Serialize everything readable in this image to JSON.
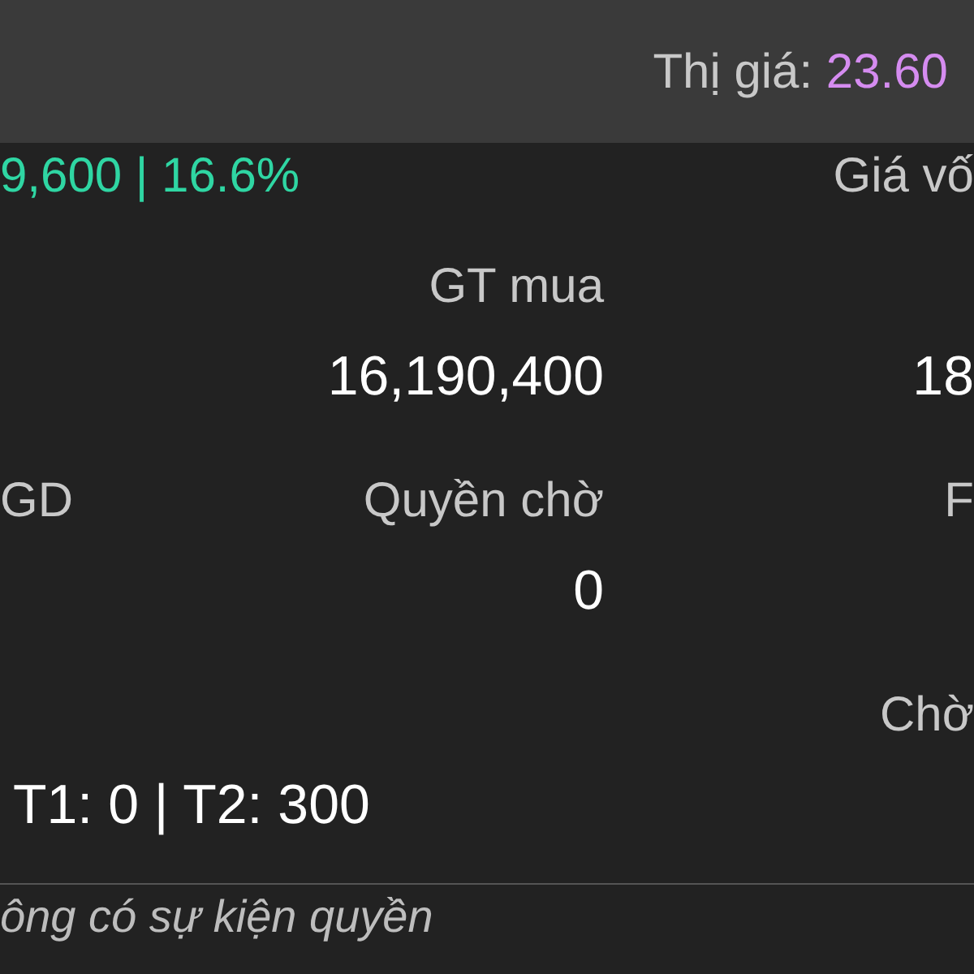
{
  "header": {
    "label": "Thị giá:",
    "value": "23.60"
  },
  "summary": {
    "change": "9,600 | 16.6%",
    "right_label": "Giá vố"
  },
  "rows": [
    {
      "kind": "label",
      "cells": {
        "col2": "GT mua"
      }
    },
    {
      "kind": "value",
      "cells": {
        "col2": "16,190,400",
        "col3": "18"
      }
    },
    {
      "kind": "label",
      "cells": {
        "col1": "GD",
        "col2": "Quyền chờ",
        "col3": "F"
      }
    },
    {
      "kind": "value",
      "cells": {
        "col2": "0"
      }
    },
    {
      "kind": "label",
      "cells": {
        "col3": "Chờ"
      }
    },
    {
      "kind": "value",
      "cells": {
        "col1": "T1: 0 | T2: 300"
      }
    }
  ],
  "footer": {
    "note": "ông có sự kiện quyền"
  }
}
